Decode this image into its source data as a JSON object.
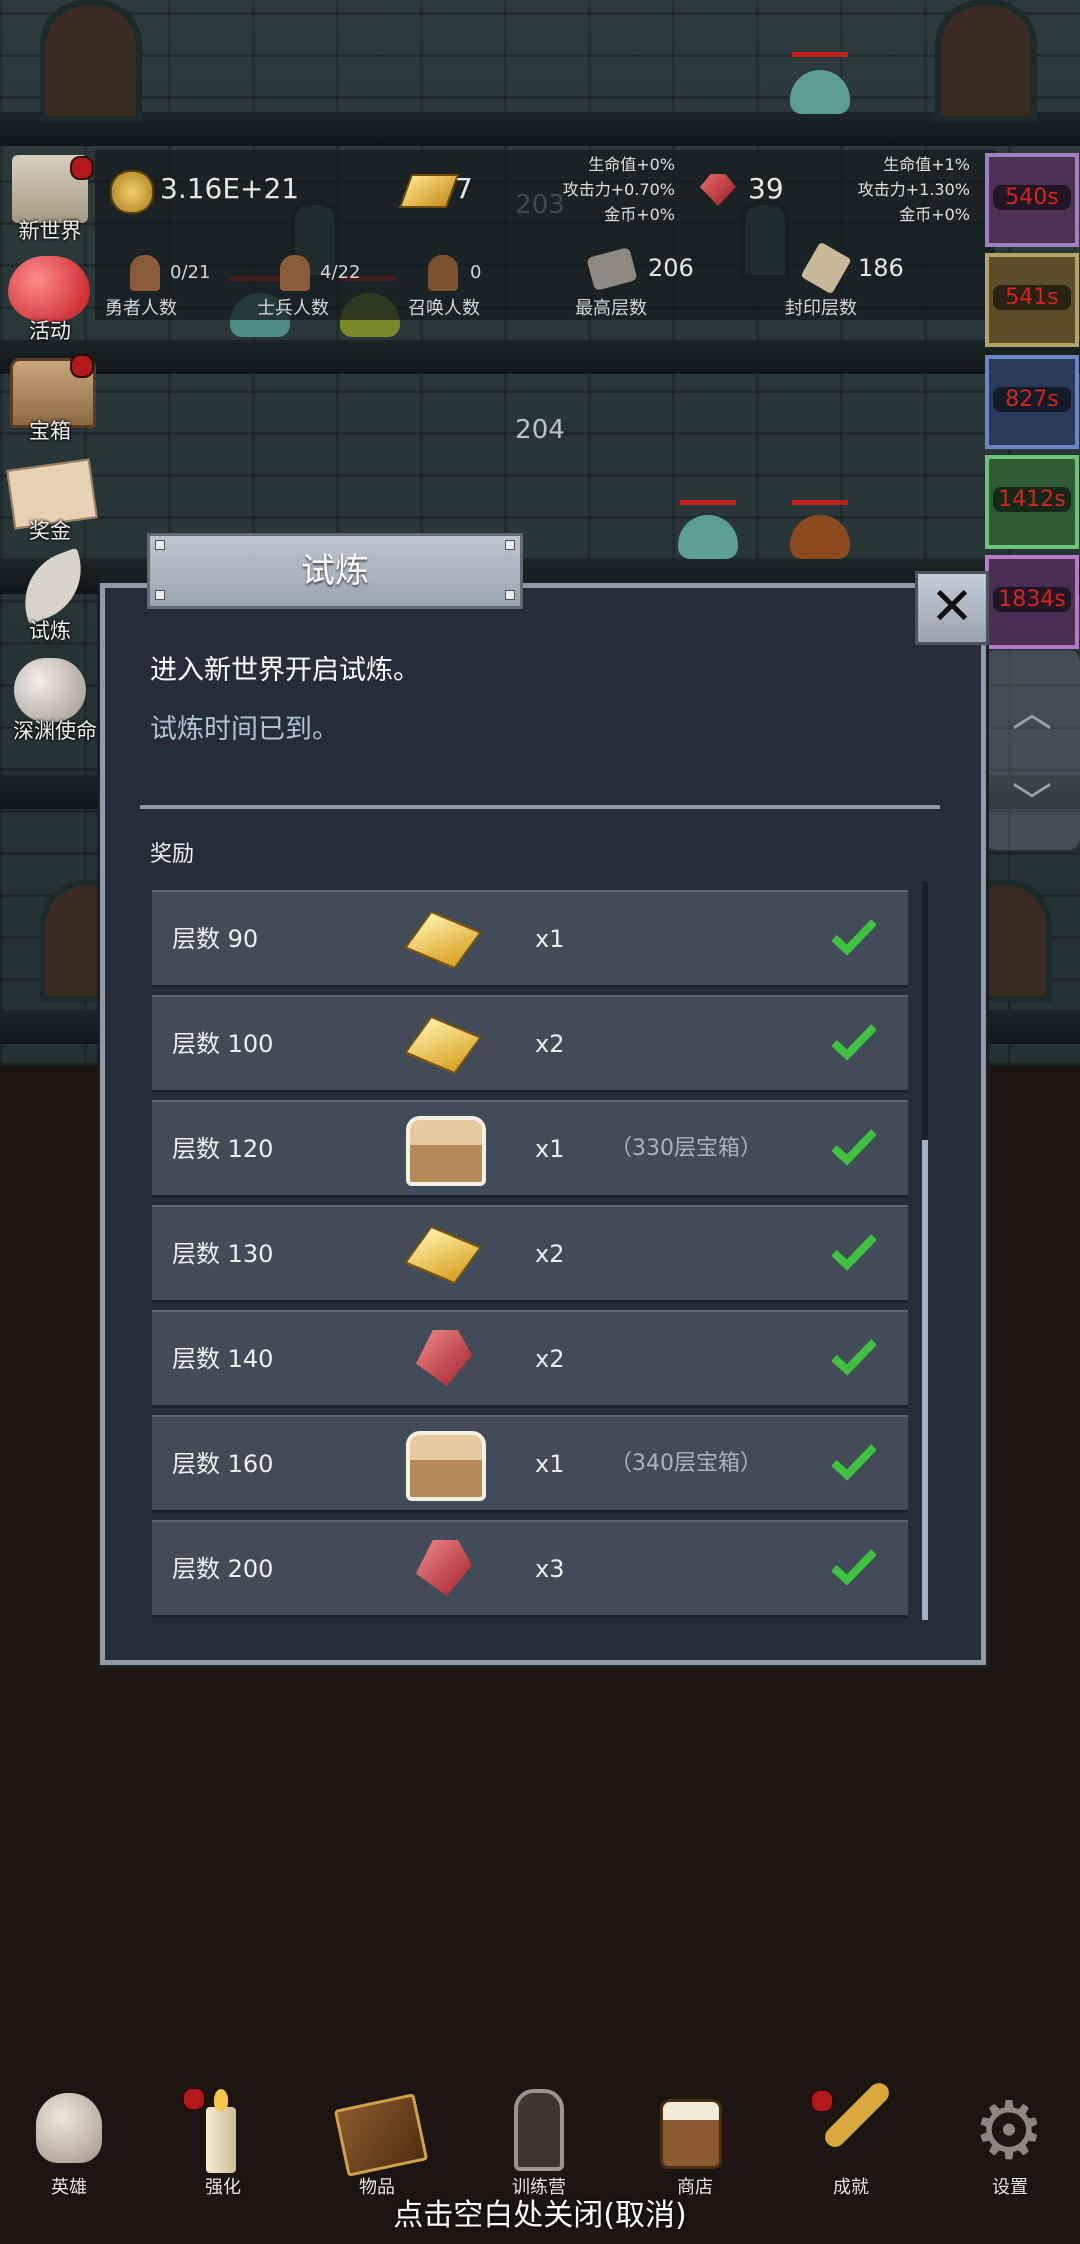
{
  "floors": {
    "upper": "203",
    "lower": "204"
  },
  "stats": {
    "gold": "3.16E+21",
    "gold_bars": "7",
    "gems": "39",
    "bonus_left": [
      "生命值+0%",
      "攻击力+0.70%",
      "金币+0%"
    ],
    "bonus_right": [
      "生命值+1%",
      "攻击力+1.30%",
      "金币+0%"
    ],
    "heroes": {
      "value": "0/21",
      "label": "勇者人数"
    },
    "soldiers": {
      "value": "4/22",
      "label": "士兵人数"
    },
    "summons": {
      "value": "0",
      "label": "召唤人数"
    },
    "max_floor": {
      "value": "206",
      "label": "最高层数"
    },
    "sealed_floor": {
      "value": "186",
      "label": "封印层数"
    }
  },
  "side_menu": [
    {
      "label": "新世界",
      "badge": true
    },
    {
      "label": "活动",
      "badge": false
    },
    {
      "label": "宝箱",
      "badge": true
    },
    {
      "label": "奖金",
      "badge": false
    },
    {
      "label": "试炼",
      "badge": false
    },
    {
      "label": "深渊使命",
      "badge": false
    }
  ],
  "timers": [
    "540s",
    "541s",
    "827s",
    "1412s",
    "1834s"
  ],
  "dialog": {
    "title": "试炼",
    "message": "进入新世界开启试炼。",
    "status": "试炼时间已到。",
    "rewards_header": "奖励",
    "close_icon": "close-x-icon",
    "rows": [
      {
        "label": "层数 90",
        "icon": "gold-bar-icon",
        "qty": "x1",
        "note": ""
      },
      {
        "label": "层数 100",
        "icon": "gold-bar-icon",
        "qty": "x2",
        "note": ""
      },
      {
        "label": "层数 120",
        "icon": "treasure-chest-icon",
        "qty": "x1",
        "note": "（330层宝箱）"
      },
      {
        "label": "层数 130",
        "icon": "gold-bar-icon",
        "qty": "x2",
        "note": ""
      },
      {
        "label": "层数 140",
        "icon": "red-gem-icon",
        "qty": "x2",
        "note": ""
      },
      {
        "label": "层数 160",
        "icon": "treasure-chest-icon",
        "qty": "x1",
        "note": "（340层宝箱）"
      },
      {
        "label": "层数 200",
        "icon": "red-gem-icon",
        "qty": "x3",
        "note": ""
      }
    ]
  },
  "bottom_nav": [
    {
      "label": "英雄",
      "icon": "skull-icon",
      "badge": false
    },
    {
      "label": "强化",
      "icon": "candle-icon",
      "badge": true
    },
    {
      "label": "物品",
      "icon": "book-icon",
      "badge": false
    },
    {
      "label": "训练营",
      "icon": "lantern-icon",
      "badge": false
    },
    {
      "label": "商店",
      "icon": "beer-mug-icon",
      "badge": false
    },
    {
      "label": "成就",
      "icon": "key-icon",
      "badge": true
    },
    {
      "label": "设置",
      "icon": "gear-icon",
      "badge": false
    }
  ],
  "close_hint": "点击空白处关闭(取消)",
  "colors": {
    "check": "#3fc23f",
    "badge": "#b3181b",
    "timer_text": "#d8231f"
  }
}
